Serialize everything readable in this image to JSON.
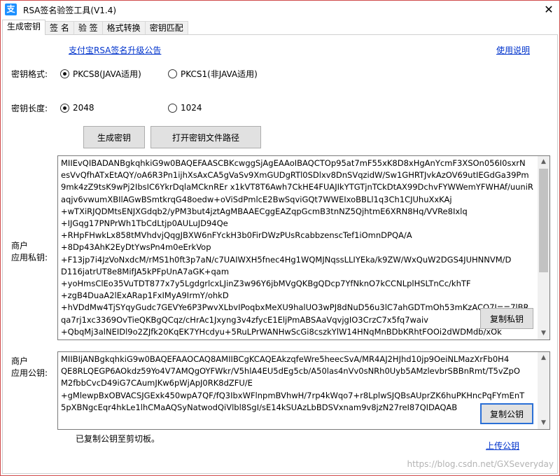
{
  "window": {
    "title": "RSA签名验签工具(V1.4)",
    "app_icon_glyph": "支",
    "close_glyph": "✕"
  },
  "tabs": [
    {
      "label": "生成密钥",
      "active": true
    },
    {
      "label": "签 名",
      "active": false
    },
    {
      "label": "验 签",
      "active": false
    },
    {
      "label": "格式转换",
      "active": false
    },
    {
      "label": "密钥匹配",
      "active": false
    }
  ],
  "links": {
    "upgrade_notice": "支付宝RSA签名升级公告",
    "usage_help": "使用说明",
    "upload_public_key": "上传公钥"
  },
  "key_format": {
    "label": "密钥格式:",
    "options": [
      "PKCS8(JAVA适用)",
      "PKCS1(非JAVA适用)"
    ],
    "selected": "PKCS8(JAVA适用)"
  },
  "key_length": {
    "label": "密钥长度:",
    "options": [
      "2048",
      "1024"
    ],
    "selected": "2048"
  },
  "buttons": {
    "generate": "生成密钥",
    "open_path": "打开密钥文件路径",
    "copy_private": "复制私钥",
    "copy_public": "复制公钥"
  },
  "private_key": {
    "label_line1": "商户",
    "label_line2": "应用私钥:",
    "text": "MIIEvQIBADANBgkqhkiG9w0BAQEFAASCBKcwggSjAgEAAoIBAQCTOp95at7mF55xK8D8xHgAnYcmF3XSOn056I0sxrN\nesVvQfhATxEtAQY/oA6R3Pn1ijhXsAxCA5gVaSv9XmGUDgRTl0SDlxv8DnSVqzidW/Sw1GHRTJvkAzOV69utIEGdGa39Pm\n9mk4zZ9tsK9wPj2IbsIC6YkrDqlaMCknREr x1kVT8T6Awh7CkHE4FUAJIkYTGTjnTCkDtAX99DchvFYWWemYFWHAf/uuniR\naqjv6vwumXBIlAGwBSmtkrqG48oedw+oViSdPmlcE2BwSqviGQt7WWEIxoBBLl1q3Ch1CJUhuXxKAj\n+wTXiRJQDMtsENJXGdqb2/yPM3but4jztAgMBAAECggEAZqpGcmB3tnNZ5QjhtmE6XRN8Hq/VVRe8Ixlq\n+IJGqg17PNPrWh1TbCdLtjp0AULuJD94Qe\n+RHpFHwkLx858tMVhdvjQqgJBXW6nFYckH3b0FirDWzPUsRcabbzenscTef1iOmnDPQA/A\n+8Dp43AhK2EyDtYwsPn4m0eErkVop\n+F13jp7i4JzVoNxdcM/rMS1h0ft3p7aN/c7UAIWXH5fnec4Hg1WQMJNqssLLIYEka/k9ZW/WxQuW2DGS4JUHNNVM/D\nD116jatrUT8e8MifJA5kPFpUnA7aGK+qam\n+yoHmsClEo35VuTDT877x7y5LgdgrlcxLJinZ3w96Y6jbMVgQKBgQDcp7YfNknO7kCCNLplHSLTnCc/khTF\n+zgB4DuaA2lExARap1FxIMyA9IrmY/ohkD\n+hVDdMw4TjSYqyGudc7GEVYe6P3PwvXLbvIPoqbxMeXU9halUO3wPJ8dNuD56u3lC7ahGDTmOh53mKzACO7I==7lBR\nqa7rj1xc3369OvTieQKBgQCqz/cHrAc1Jxyng3v4zfycE1EljPmABSAaVqvjgIO3CrzC7x5fq7waiv\n+QbqMj3alNEIDl9o2ZJfk20KqEK7YHcdyu+5RuLPrWANHwScGi8cszkYlW14HNqMnBDbKRhtFOOi2dWDMdb/xOk"
  },
  "public_key": {
    "label_line1": "商户",
    "label_line2": "应用公钥:",
    "text": "MIIBIjANBgkqhkiG9w0BAQEFAAOCAQ8AMIIBCgKCAQEAkzqfeWre5heecSvA/MR4AJ2HJhd10jp9OeiNLMazXrFb0H4\nQE8RLQEGP6AOkdz59Yo4V7AMQgOYFWkr/V5hlA4EU5dEg5cb/A50las4nVv0sNRh0Uyb5AMzlevbrSBBnRmt/T5vZpO\nM2fbbCvcD49iG7CAumJKw6pWjApJ0RK8dZFU/E\n+gMlewpBxOBVACSJGExk450wpA7QF/fQ3IbxWFlnpmBVhwH/7rp4kWqo7+r8LplwSJQBsAUprZK6huPKHncPqFYmEnT\n5pXBNgcEqr4hkLe1lhCMaAQSyNatwodQiVlbl8SgI/sE14kSUAzLbBDSVxnam9v8jzN27reI87QIDAQAB"
  },
  "status": "已复制公钥至剪切板。",
  "watermark": "https://blog.csdn.net/GXSeveryday"
}
